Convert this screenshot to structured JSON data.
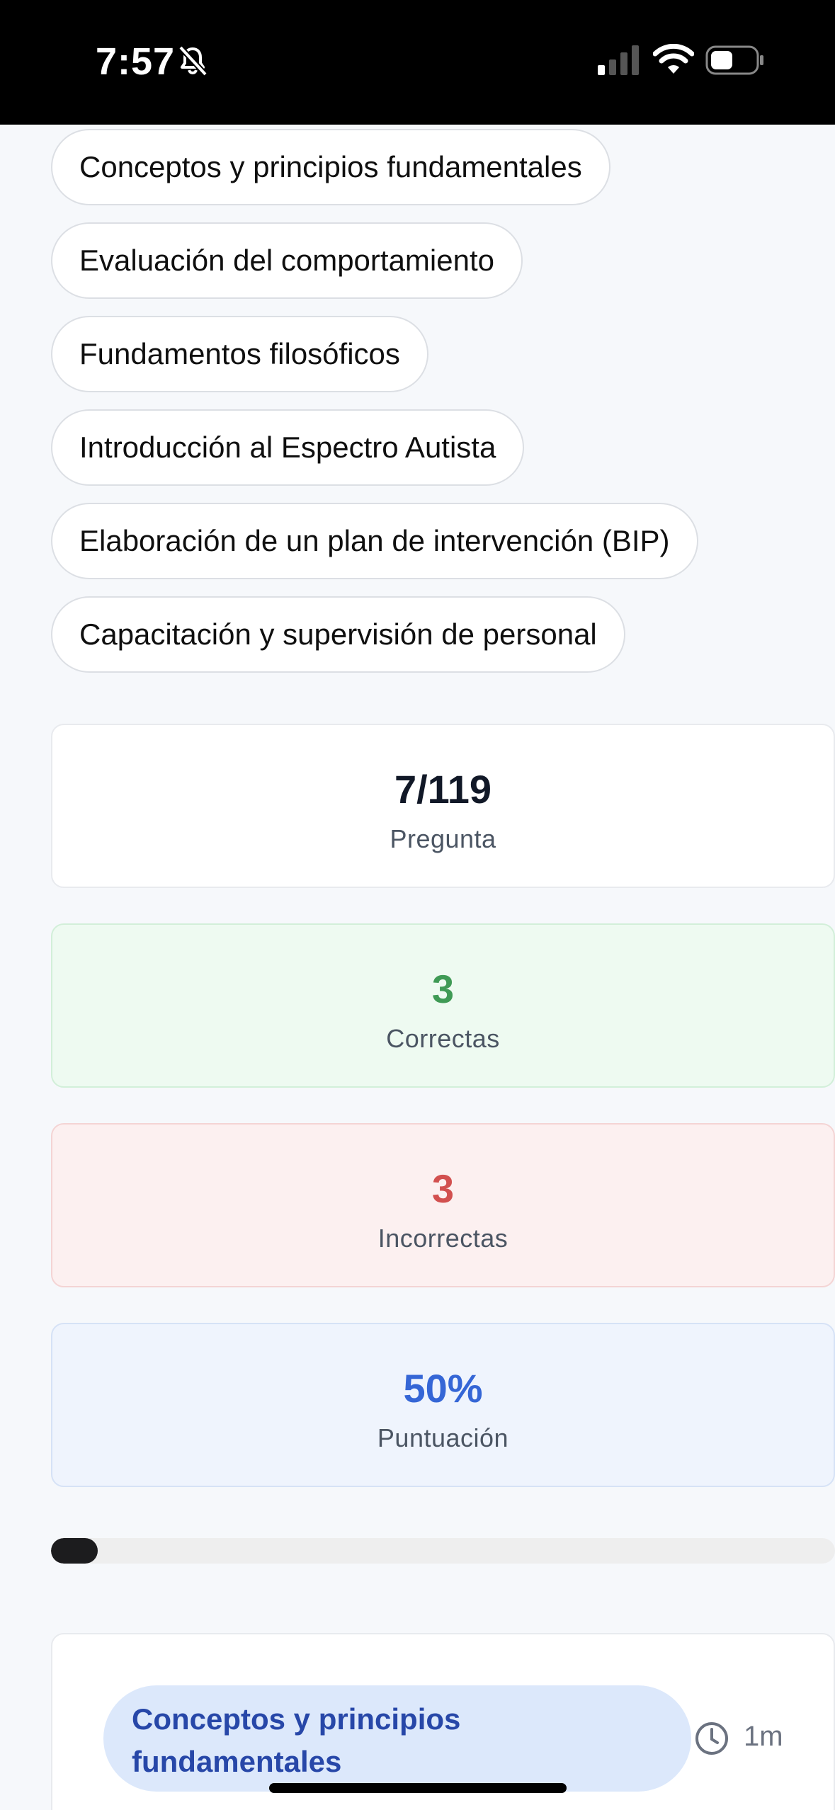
{
  "status_bar": {
    "time": "7:57",
    "icons": [
      "bell-slash-icon",
      "signal-icon",
      "wifi-icon",
      "battery-icon"
    ]
  },
  "topics": [
    "Conceptos y principios fundamentales",
    "Evaluación del comportamiento",
    "Fundamentos filosóficos",
    "Introducción al Espectro Autista",
    "Elaboración de un plan de intervención (BIP)",
    "Capacitación y supervisión de personal"
  ],
  "stats": {
    "question": {
      "value": "7/119",
      "label": "Pregunta"
    },
    "correct": {
      "value": "3",
      "label": "Correctas"
    },
    "incorrect": {
      "value": "3",
      "label": "Incorrectas"
    },
    "score": {
      "value": "50%",
      "label": "Puntuación"
    }
  },
  "progress": {
    "current": 7,
    "total": 119,
    "fraction": 0.06
  },
  "question_card": {
    "topic": "Conceptos y principios fundamentales",
    "time": "1m"
  },
  "colors": {
    "correct": "#3f9a55",
    "incorrect": "#d2504f",
    "score": "#3566d6",
    "topic_pill_bg": "#dce8fb",
    "topic_pill_text": "#2747a8"
  }
}
